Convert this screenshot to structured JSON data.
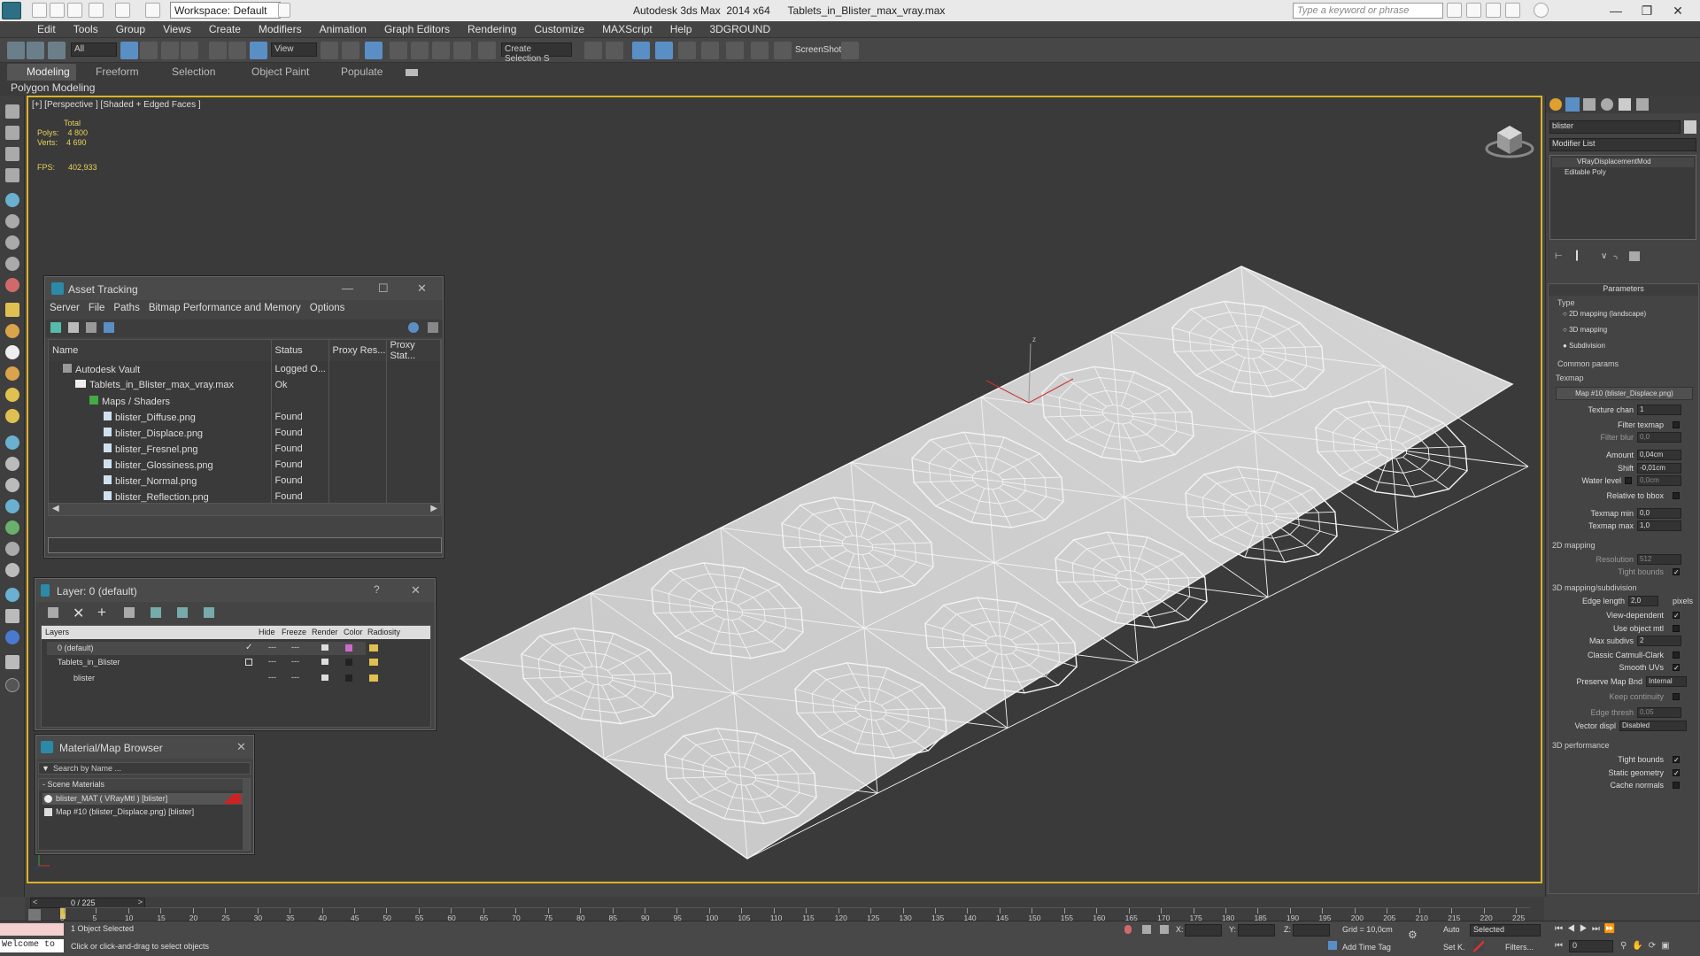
{
  "app": {
    "title": "Autodesk 3ds Max  2014 x64      Tablets_in_Blister_max_vray.max",
    "workspace": "Workspace: Default",
    "search_placeholder": "Type a keyword or phrase"
  },
  "menu": [
    "Edit",
    "Tools",
    "Group",
    "Views",
    "Create",
    "Modifiers",
    "Animation",
    "Graph Editors",
    "Rendering",
    "Customize",
    "MAXScript",
    "Help",
    "3DGROUND"
  ],
  "toolbar": {
    "filter_select": "All",
    "ref_coord": "View",
    "named_selection": "Create Selection S",
    "screenshot_label": "ScreenShot"
  },
  "ribbon": {
    "tabs": [
      "Modeling",
      "Freeform",
      "Selection",
      "Object Paint",
      "Populate"
    ],
    "panel": "Polygon Modeling"
  },
  "viewport": {
    "label": "[+] [Perspective ] [Shaded + Edged Faces ]",
    "stats_total": "Total",
    "polys_label": "Polys:",
    "polys_value": "4 800",
    "verts_label": "Verts:",
    "verts_value": "4 690",
    "fps_label": "FPS:",
    "fps_value": "402,933"
  },
  "asset_tracking": {
    "title": "Asset Tracking",
    "menu": [
      "Server",
      "File",
      "Paths",
      "Bitmap Performance and Memory",
      "Options"
    ],
    "columns": [
      "Name",
      "Status",
      "Proxy Res...",
      "Proxy Stat..."
    ],
    "rows": [
      {
        "name": "Autodesk Vault",
        "status": "Logged O..."
      },
      {
        "name": "Tablets_in_Blister_max_vray.max",
        "status": "Ok"
      },
      {
        "name": "Maps / Shaders",
        "status": ""
      },
      {
        "name": "blister_Diffuse.png",
        "status": "Found"
      },
      {
        "name": "blister_Displace.png",
        "status": "Found"
      },
      {
        "name": "blister_Fresnel.png",
        "status": "Found"
      },
      {
        "name": "blister_Glossiness.png",
        "status": "Found"
      },
      {
        "name": "blister_Normal.png",
        "status": "Found"
      },
      {
        "name": "blister_Reflection.png",
        "status": "Found"
      }
    ]
  },
  "layers": {
    "title": "Layer: 0 (default)",
    "question": "?",
    "columns": [
      "Layers",
      "Hide",
      "Freeze",
      "Render",
      "Color",
      "Radiosity"
    ],
    "rows": [
      {
        "name": "0 (default)",
        "color": "#d06ac8"
      },
      {
        "name": "Tablets_in_Blister",
        "color": "#222222"
      },
      {
        "name": "blister",
        "color": "#222222"
      }
    ]
  },
  "material_browser": {
    "title": "Material/Map Browser",
    "search_placeholder": "Search by Name ...",
    "section": "- Scene Materials",
    "items": [
      "blister_MAT  ( VRayMtl )  [blister]",
      "Map #10 (blister_Displace.png)  [blister]"
    ]
  },
  "modify_panel": {
    "object_name": "blister",
    "modifier_list": "Modifier List",
    "stack": [
      "VRayDisplacementMod",
      "Editable Poly"
    ],
    "parameters_title": "Parameters",
    "type_label": "Type",
    "type_options": [
      "2D mapping (landscape)",
      "3D mapping",
      "Subdivision"
    ],
    "common_params": "Common params",
    "texmap_label": "Texmap",
    "texmap_button": "Map #10 (blister_Displace.png)",
    "fields": [
      {
        "label": "Texture chan",
        "value": "1"
      },
      {
        "label": "Filter texmap",
        "value": ""
      },
      {
        "label": "Filter blur",
        "value": "0,0"
      },
      {
        "label": "Amount",
        "value": "0,04cm"
      },
      {
        "label": "Shift",
        "value": "-0,01cm"
      },
      {
        "label": "Water level",
        "value": "0,0cm"
      },
      {
        "label": "Relative to bbox",
        "value": ""
      },
      {
        "label": "Texmap min",
        "value": "0,0"
      },
      {
        "label": "Texmap max",
        "value": "1,0"
      }
    ],
    "mapping2d_title": "2D mapping",
    "resolution_label": "Resolution",
    "resolution_value": "512",
    "tight_bounds_label": "Tight bounds",
    "subdiv_title": "3D mapping/subdivision",
    "edge_length_label": "Edge length",
    "edge_length_value": "2,0",
    "pixels_label": "pixels",
    "view_dependent": "View-dependent",
    "use_object_mtl": "Use object mtl",
    "max_subdivs_label": "Max subdivs",
    "max_subdivs_value": "2",
    "classic_catmull": "Classic Catmull-Clark",
    "smooth_uvs": "Smooth UVs",
    "preserve_map_bnd": "Preserve Map Bnd",
    "preserve_value": "Internal",
    "keep_continuity": "Keep continuity",
    "edge_thresh_label": "Edge thresh",
    "edge_thresh_value": "0,05",
    "vector_displ_label": "Vector displ",
    "vector_displ_value": "Disabled",
    "perf_title": "3D performance",
    "perf_items": [
      "Tight bounds",
      "Static geometry",
      "Cache normals"
    ]
  },
  "timeline": {
    "frame": "0 / 225",
    "ticks": [
      "0",
      "5",
      "10",
      "15",
      "20",
      "25",
      "30",
      "35",
      "40",
      "45",
      "50",
      "55",
      "60",
      "65",
      "70",
      "75",
      "80",
      "85",
      "90",
      "95",
      "100",
      "105",
      "110",
      "115",
      "120",
      "125",
      "130",
      "135",
      "140",
      "145",
      "150",
      "155",
      "160",
      "165",
      "170",
      "175",
      "180",
      "185",
      "190",
      "195",
      "200",
      "205",
      "210",
      "215",
      "220",
      "225"
    ]
  },
  "status": {
    "welcome": "Welcome to",
    "selected": "1 Object Selected",
    "hint": "Click or click-and-drag to select objects",
    "x_label": "X:",
    "y_label": "Y:",
    "z_label": "Z:",
    "grid": "Grid = 10,0cm",
    "add_time_tag": "Add Time Tag",
    "auto": "Auto",
    "set_key": "Set K.",
    "key_filter": "Selected",
    "filters": "Filters...",
    "frame_field": "0"
  }
}
